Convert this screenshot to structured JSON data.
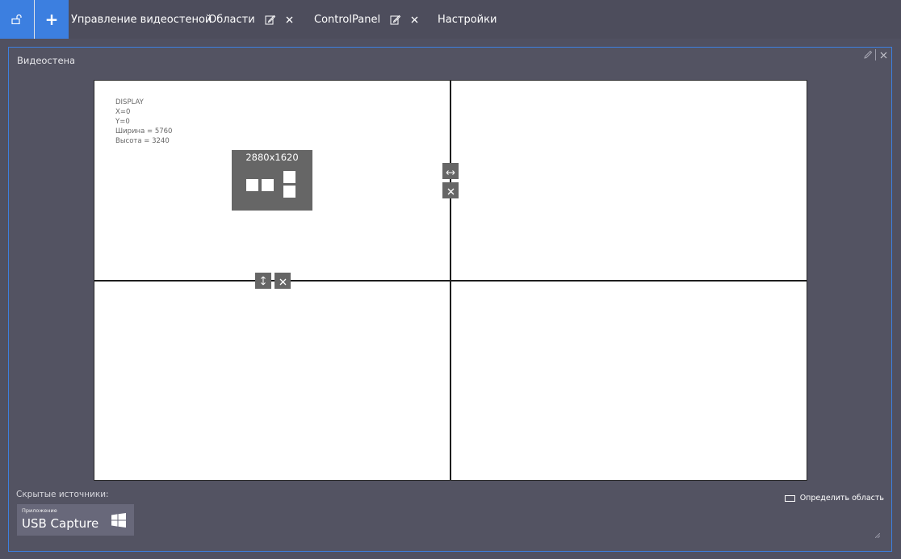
{
  "topbar": {
    "lock_icon": "unlock-icon",
    "plus_label": "+",
    "tabs": [
      {
        "label": "Управление видеостеной"
      },
      {
        "label": "Области",
        "edit_icon": "edit-icon",
        "close_icon": "close-icon"
      },
      {
        "label": "ControlPanel",
        "edit_icon": "edit-icon",
        "close_icon": "close-icon"
      },
      {
        "label": "Настройки"
      }
    ]
  },
  "panel": {
    "title": "Видеостена",
    "tools": [
      "pencil-icon",
      "close-icon"
    ]
  },
  "videowall": {
    "display_info": [
      "DISPLAY",
      "X=0",
      "Y=0",
      "Ширина = 5760",
      "Высота = 3240"
    ],
    "resolution": "2880x1620"
  },
  "hidden_sources": {
    "label": "Скрытые источники:",
    "items": [
      {
        "type_label": "Приложение",
        "name": "USB Capture",
        "icon": "windows-icon"
      }
    ]
  },
  "define_area": {
    "label": "Определить область"
  },
  "colors": {
    "accent": "#3c7fe0",
    "background": "#505060",
    "control_gray": "#666666"
  }
}
